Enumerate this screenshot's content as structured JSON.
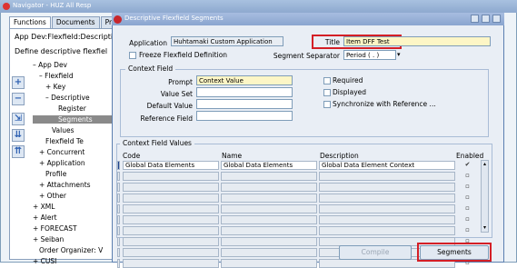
{
  "navigator": {
    "title": "Navigator - HUZ All Resp",
    "tabs": [
      "Functions",
      "Documents",
      "Proce"
    ],
    "breadcrumb": "App Dev:Flexfield:Descripti",
    "subtitle": "Define descriptive flexfiel",
    "tree": [
      {
        "text": "–  App Dev",
        "indent": 0
      },
      {
        "text": "–  Flexfield",
        "indent": 1
      },
      {
        "text": "+  Key",
        "indent": 2
      },
      {
        "text": "–  Descriptive",
        "indent": 2
      },
      {
        "text": "Register",
        "indent": 4
      },
      {
        "text": "Segments",
        "indent": 4,
        "selected": true
      },
      {
        "text": "Values",
        "indent": 3
      },
      {
        "text": "Flexfield Te",
        "indent": 2
      },
      {
        "text": "+  Concurrent",
        "indent": 1
      },
      {
        "text": "+  Application",
        "indent": 1
      },
      {
        "text": "Profile",
        "indent": 2
      },
      {
        "text": "+  Attachments",
        "indent": 1
      },
      {
        "text": "+  Other",
        "indent": 1
      },
      {
        "text": "+  XML",
        "indent": 0
      },
      {
        "text": "+  Alert",
        "indent": 0
      },
      {
        "text": "+  FORECAST",
        "indent": 0
      },
      {
        "text": "+  Seiban",
        "indent": 0
      },
      {
        "text": "Order Organizer: V",
        "indent": 1
      },
      {
        "text": "+  CUSI",
        "indent": 0
      }
    ]
  },
  "dialog": {
    "title": "Descriptive Flexfield Segments",
    "application_label": "Application",
    "application_value": "Huhtamaki Custom Application",
    "title_label": "Title",
    "title_value": "Item DFF Test",
    "freeze_label": "Freeze Flexfield Definition",
    "separator_label": "Segment Separator",
    "separator_value": "Period ( . )",
    "context_field": {
      "group_title": "Context Field",
      "prompt_label": "Prompt",
      "prompt_value": "Context Value",
      "value_set_label": "Value Set",
      "value_set_value": "",
      "default_label": "Default Value",
      "default_value": "",
      "reference_label": "Reference Field",
      "reference_value": "",
      "required_label": "Required",
      "displayed_label": "Displayed",
      "sync_label": "Synchronize with Reference ..."
    },
    "values_group_title": "Context Field Values",
    "columns": {
      "code": "Code",
      "name": "Name",
      "description": "Description",
      "enabled": "Enabled"
    },
    "rows": [
      {
        "code": "Global Data Elements",
        "name": "Global Data Elements",
        "description": "Global Data Element Context",
        "enabled": true
      }
    ],
    "empty_row_count": 9,
    "buttons": {
      "compile": "Compile",
      "segments": "Segments"
    }
  }
}
